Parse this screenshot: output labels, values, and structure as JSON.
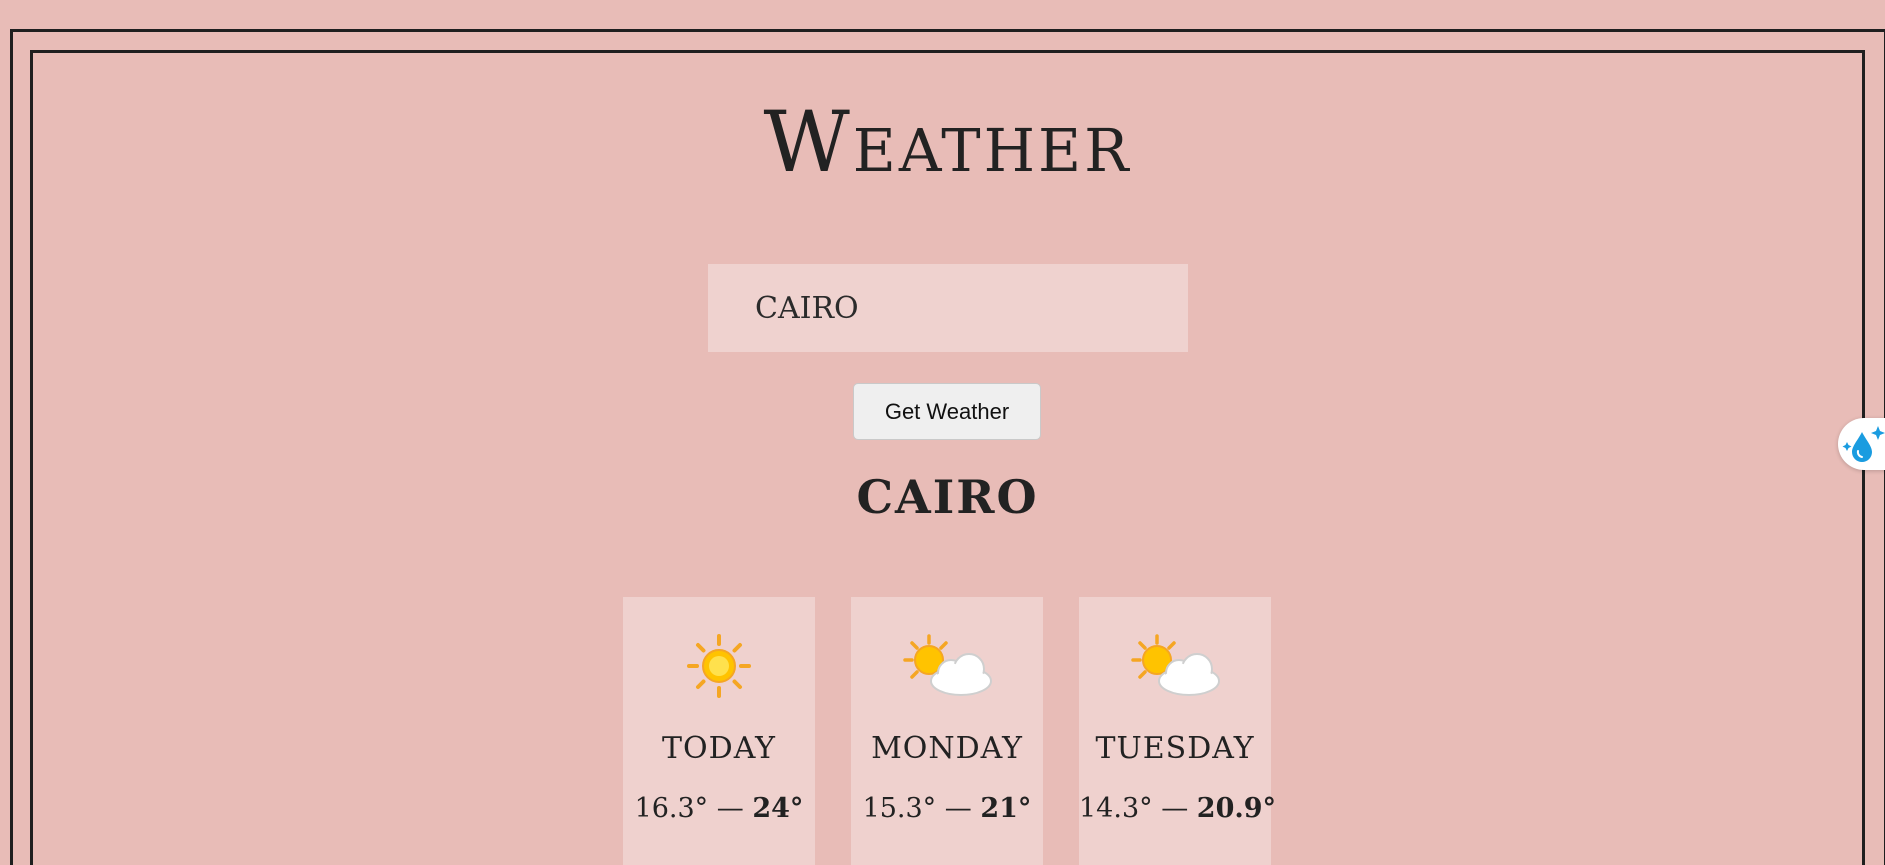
{
  "header": {
    "title": "Weather"
  },
  "search": {
    "value": "cairo"
  },
  "button": {
    "label": "Get Weather"
  },
  "result": {
    "city": "Cairo"
  },
  "forecast": [
    {
      "day": "Today",
      "icon": "sun-icon",
      "low": "16.3°",
      "separator": " — ",
      "high": "24°"
    },
    {
      "day": "Monday",
      "icon": "sun-behind-cloud-icon",
      "low": "15.3°",
      "separator": " — ",
      "high": "21°"
    },
    {
      "day": "Tuesday",
      "icon": "sun-behind-cloud-icon",
      "low": "14.3°",
      "separator": " — ",
      "high": "20.9°"
    }
  ],
  "extension": {
    "icon": "water-drop-sparkle-icon"
  },
  "colors": {
    "background": "#e8bcb7",
    "card": "#efd1ce",
    "border": "#1f1f1f",
    "sun": "#ffc300",
    "sun_ray": "#f5a623",
    "extension_accent": "#1a9ce0"
  }
}
